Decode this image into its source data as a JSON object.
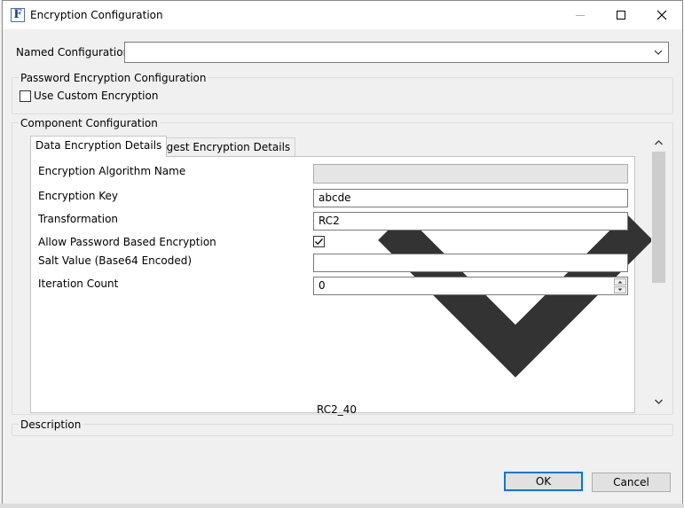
{
  "window": {
    "title": "Encryption Configuration",
    "icon_glyph": "F"
  },
  "named_config": {
    "label": "Named Configuration",
    "value": ""
  },
  "password_group": {
    "caption": "Password Encryption Configuration",
    "checkbox_label": "Use Custom Encryption",
    "checked": false
  },
  "component_group": {
    "caption": "Component Configuration",
    "tabs": [
      {
        "label": "Data Encryption Details",
        "active": true
      },
      {
        "label": "Digest Encryption Details",
        "active": false
      }
    ],
    "fields": {
      "algorithm": {
        "label": "Encryption Algorithm Name",
        "value": "RC2_40"
      },
      "key": {
        "label": "Encryption Key",
        "value": "abcde"
      },
      "transformation": {
        "label": "Transformation",
        "value": "RC2"
      },
      "allow_pbe": {
        "label": "Allow Password Based Encryption",
        "checked": true
      },
      "salt": {
        "label": "Salt Value (Base64 Encoded)",
        "value": ""
      },
      "iteration": {
        "label": "Iteration Count",
        "value": "0"
      }
    }
  },
  "description_group": {
    "caption": "Description"
  },
  "buttons": {
    "ok": "OK",
    "cancel": "Cancel"
  },
  "colors": {
    "accent": "#0078d7",
    "dialog_bg": "#f0f0f0"
  }
}
